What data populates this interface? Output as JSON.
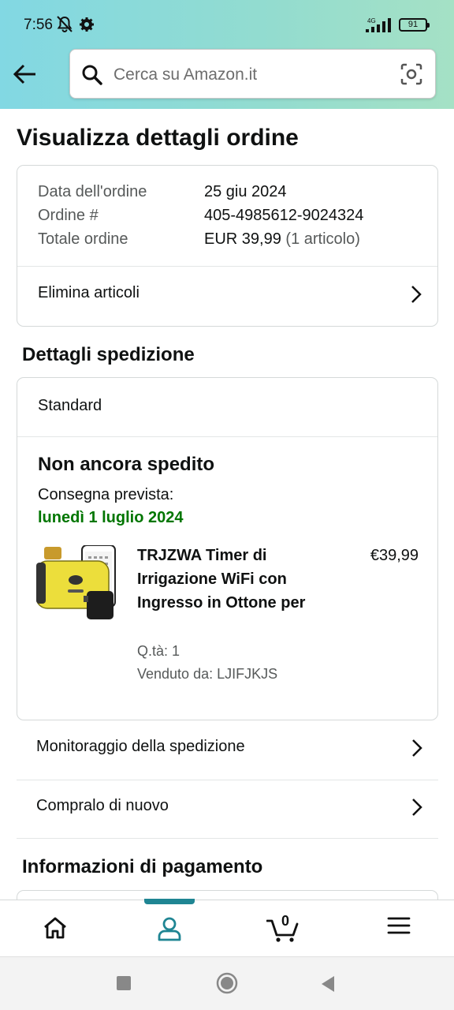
{
  "status_bar": {
    "time": "7:56",
    "network": "4G",
    "battery": "91"
  },
  "search": {
    "placeholder": "Cerca su Amazon.it"
  },
  "page": {
    "title": "Visualizza dettagli ordine"
  },
  "order": {
    "date_label": "Data dell'ordine",
    "date_value": "25 giu 2024",
    "number_label": "Ordine #",
    "number_value": "405-4985612-9024324",
    "total_label": "Totale ordine",
    "total_value": "EUR 39,99",
    "total_items": "(1 articolo)",
    "delete_items": "Elimina articoli"
  },
  "shipping": {
    "section_title": "Dettagli spedizione",
    "method": "Standard",
    "status": "Non ancora spedito",
    "eta_label": "Consegna prevista:",
    "eta_date": "lunedì 1 luglio 2024",
    "colors": {
      "eta": "#007600"
    },
    "product": {
      "title": "TRJZWA Timer di Irrigazione WiFi con Ingresso in Ottone per",
      "price": "€39,99",
      "qty": "Q.tà: 1",
      "seller": "Venduto da: LJIFJKJS"
    }
  },
  "actions": {
    "track": "Monitoraggio della spedizione",
    "buy_again": "Compralo di nuovo"
  },
  "payment": {
    "section_title": "Informazioni di pagamento"
  },
  "bottom_nav": {
    "active": "account",
    "cart_count": "0",
    "accent": "#1f8593"
  }
}
